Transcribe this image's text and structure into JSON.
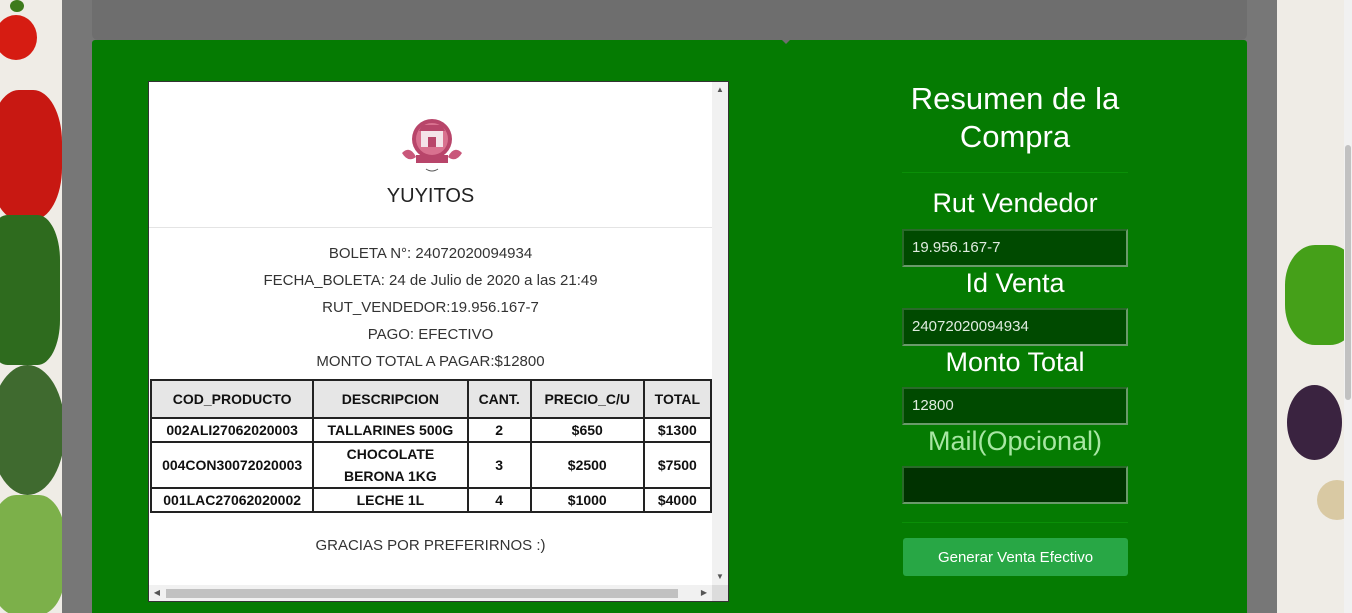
{
  "receipt": {
    "store_name": "YUYITOS",
    "boleta_line": "BOLETA N°: 24072020094934",
    "fecha_line": "FECHA_BOLETA: 24 de Julio de 2020 a las 21:49",
    "rut_line": "RUT_VENDEDOR:19.956.167-7",
    "pago_line": "PAGO: EFECTIVO",
    "monto_line": "MONTO TOTAL A PAGAR:$12800",
    "columns": [
      "COD_PRODUCTO",
      "DESCRIPCION",
      "CANT.",
      "PRECIO_C/U",
      "TOTAL"
    ],
    "rows": [
      {
        "codigo": "002ALI27062020003",
        "descripcion": "TALLARINES 500G",
        "cant": "2",
        "precio": "$650",
        "total": "$1300"
      },
      {
        "codigo": "004CON30072020003",
        "descripcion": "CHOCOLATE BERONA 1KG",
        "cant": "3",
        "precio": "$2500",
        "total": "$7500"
      },
      {
        "codigo": "001LAC27062020002",
        "descripcion": "LECHE 1L",
        "cant": "4",
        "precio": "$1000",
        "total": "$4000"
      }
    ],
    "thanks": "GRACIAS POR PREFERIRNOS :)",
    "logo_icon": "store-logo-icon"
  },
  "summary": {
    "title": "Resumen de la Compra",
    "rut_label": "Rut Vendedor",
    "rut_value": "19.956.167-7",
    "id_label": "Id Venta",
    "id_value": "24072020094934",
    "monto_label": "Monto Total",
    "monto_value": "12800",
    "mail_label": "Mail(Opcional)",
    "mail_value": "",
    "button_label": "Generar Venta Efectivo"
  },
  "colors": {
    "modal_bg": "#057b02",
    "input_bg": "#004a00",
    "button_bg": "#28a745"
  }
}
